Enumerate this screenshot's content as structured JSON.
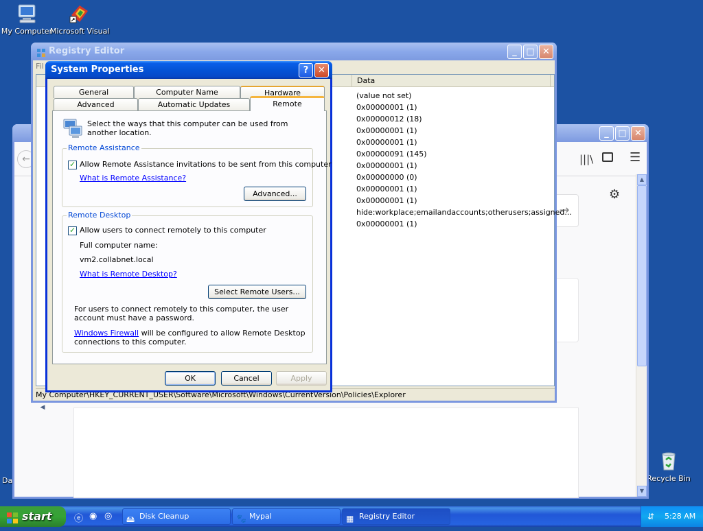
{
  "desktop": {
    "icons": [
      {
        "label": "My Computer"
      },
      {
        "label": "Microsoft Visual"
      },
      {
        "label": "Recycle Bin"
      }
    ],
    "partial_label": "Da"
  },
  "registry_editor": {
    "title": "Registry Editor",
    "menu_partial": "Fil",
    "column_data": "Data",
    "rows": [
      "(value not set)",
      "0x00000001 (1)",
      "0x00000012 (18)",
      "0x00000001 (1)",
      "0x00000001 (1)",
      "0x00000091 (145)",
      "0x00000001 (1)",
      "0x00000000 (0)",
      "0x00000001 (1)",
      "0x00000001 (1)",
      "hide:workplace;emailandaccounts;otherusers;assigned...",
      "0x00000001 (1)"
    ],
    "status_path": "My Computer\\HKEY_CURRENT_USER\\Software\\Microsoft\\Windows\\CurrentVersion\\Policies\\Explorer"
  },
  "system_properties": {
    "title": "System Properties",
    "tabs_row1": [
      "General",
      "Computer Name",
      "Hardware"
    ],
    "tabs_row2": [
      "Advanced",
      "Automatic Updates",
      "Remote"
    ],
    "intro": "Select the ways that this computer can be used from another location.",
    "remote_assistance": {
      "legend": "Remote Assistance",
      "checkbox_label": "Allow Remote Assistance invitations to be sent from this computer",
      "checked": true,
      "link": "What is Remote Assistance?",
      "advanced_button": "Advanced..."
    },
    "remote_desktop": {
      "legend": "Remote Desktop",
      "checkbox_label": "Allow users to connect remotely to this computer",
      "checked": true,
      "full_name_label": "Full computer name:",
      "computer_name": "vm2.collabnet.local",
      "link": "What is Remote Desktop?",
      "select_users_button": "Select Remote Users...",
      "note": "For users to connect remotely to this computer, the user account must have a password.",
      "firewall_link": "Windows Firewall",
      "firewall_text": " will be configured to allow Remote Desktop connections to this computer."
    },
    "buttons": {
      "ok": "OK",
      "cancel": "Cancel",
      "apply": "Apply"
    }
  },
  "taskbar": {
    "start": "start",
    "tasks": [
      "Disk Cleanup",
      "Mypal",
      "Registry Editor"
    ],
    "clock": "5:28 AM"
  }
}
